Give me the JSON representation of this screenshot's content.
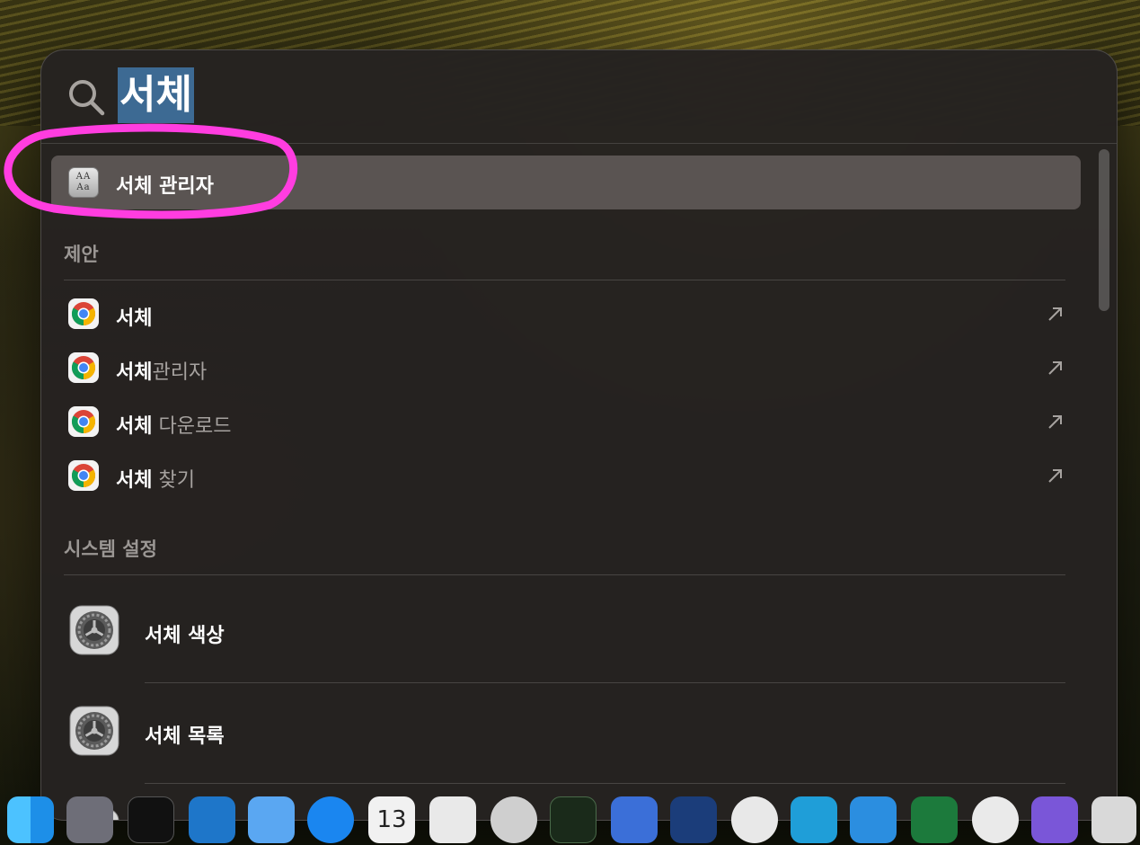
{
  "search": {
    "query": "서체"
  },
  "top_hit": {
    "label": "서체 관리자",
    "icon": "font-book-icon",
    "icon_text": "AA Aa"
  },
  "suggestions_section": {
    "header": "제안",
    "items": [
      {
        "bold": "서체",
        "rest": "",
        "icon": "chrome-icon"
      },
      {
        "bold": "서체",
        "rest": "관리자",
        "icon": "chrome-icon"
      },
      {
        "bold": "서체",
        "rest": " 다운로드",
        "icon": "chrome-icon"
      },
      {
        "bold": "서체",
        "rest": " 찾기",
        "icon": "chrome-icon"
      }
    ]
  },
  "system_settings_section": {
    "header": "시스템 설정",
    "items": [
      {
        "label": "서체 색상",
        "icon": "system-settings-gear-icon"
      },
      {
        "label": "서체 목록",
        "icon": "system-settings-gear-icon"
      }
    ]
  },
  "colors": {
    "query_highlight": "#3d6a93",
    "annotation_circle": "#ff3de0",
    "selected_row": "#5a5452"
  },
  "dock": {
    "icons": [
      "finder-icon",
      "launchpad-icon",
      "terminal-icon",
      "vscode-icon",
      "mail-icon",
      "app-store-icon",
      "calendar-icon",
      "notes-icon",
      "safari-icon",
      "activity-monitor-icon",
      "zoom-icon",
      "xcode-icon",
      "chrome-icon",
      "app-icon",
      "app-icon",
      "excel-icon",
      "app-icon",
      "app-icon",
      "app-icon"
    ],
    "calendar_day": "13"
  }
}
